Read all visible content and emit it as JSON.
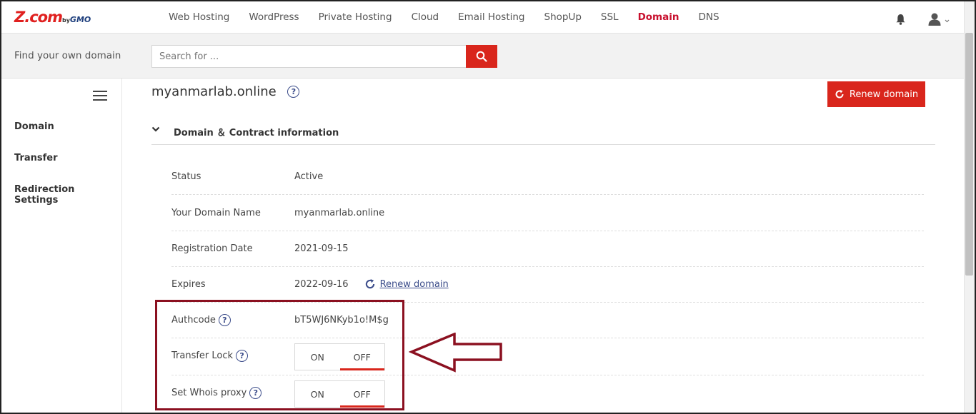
{
  "brand": {
    "logo_main": "Z.com",
    "logo_by": "by",
    "logo_gmo": "GMO"
  },
  "nav": {
    "items": [
      "Web Hosting",
      "WordPress",
      "Private Hosting",
      "Cloud",
      "Email Hosting",
      "ShopUp",
      "SSL",
      "Domain",
      "DNS"
    ],
    "active": "Domain"
  },
  "search": {
    "label": "Find your own domain",
    "placeholder": "Search for ..."
  },
  "sidebar": {
    "items": [
      {
        "label": "Domain"
      },
      {
        "label": "Transfer"
      },
      {
        "label": "Redirection Settings"
      }
    ]
  },
  "main": {
    "domain_title": "myanmarlab.online",
    "renew_button": "Renew domain",
    "section_title": "Domain ＆ Contract information",
    "rows": {
      "status": {
        "label": "Status",
        "value": "Active"
      },
      "domain_name": {
        "label": "Your Domain Name",
        "value": "myanmarlab.online"
      },
      "registration_date": {
        "label": "Registration Date",
        "value": "2021-09-15"
      },
      "expires": {
        "label": "Expires",
        "value": "2022-09-16",
        "link": "Renew domain"
      },
      "authcode": {
        "label": "Authcode",
        "value": "bT5WJ6NKyb1o!M$g"
      },
      "transfer_lock": {
        "label": "Transfer Lock",
        "on": "ON",
        "off": "OFF",
        "selected": "OFF"
      },
      "whois_proxy": {
        "label": "Set Whois proxy",
        "on": "ON",
        "off": "OFF",
        "selected": "OFF"
      }
    }
  },
  "colors": {
    "accent": "#d9261c",
    "annotation": "#8b1020",
    "help": "#3b4c8a"
  }
}
